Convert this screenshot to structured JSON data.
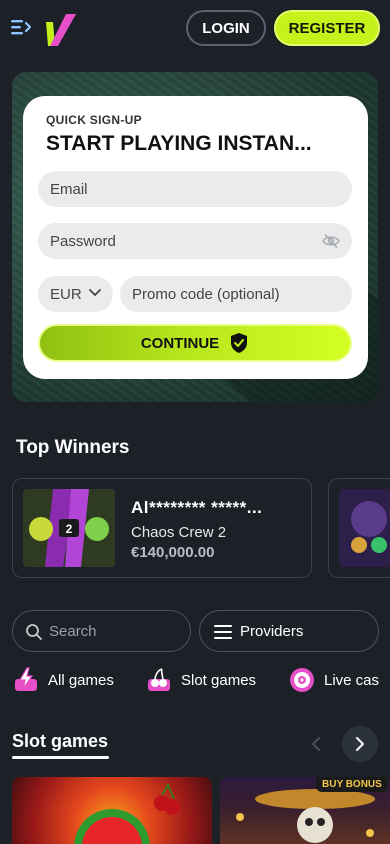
{
  "header": {
    "login_label": "LOGIN",
    "register_label": "REGISTER"
  },
  "signup": {
    "kicker": "QUICK SIGN-UP",
    "title": "START PLAYING INSTAN...",
    "email_placeholder": "Email",
    "password_placeholder": "Password",
    "currency": "EUR",
    "promo_placeholder": "Promo code (optional)",
    "continue_label": "CONTINUE"
  },
  "top_winners": {
    "title": "Top Winners",
    "items": [
      {
        "name": "Al******** *****...",
        "game": "Chaos Crew 2",
        "amount": "€140,000.00"
      }
    ]
  },
  "search": {
    "placeholder": "Search"
  },
  "providers": {
    "label": "Providers"
  },
  "categories": [
    {
      "label": "All games",
      "icon": "lightning-icon"
    },
    {
      "label": "Slot games",
      "icon": "cherry-icon"
    },
    {
      "label": "Live cas",
      "icon": "roulette-icon"
    }
  ],
  "slot_games": {
    "title": "Slot games",
    "bonus_tag": "BUY BONUS"
  },
  "colors": {
    "background": "#1c2128",
    "accent": "#c5f21b",
    "category_icon": "#e64fc7"
  }
}
